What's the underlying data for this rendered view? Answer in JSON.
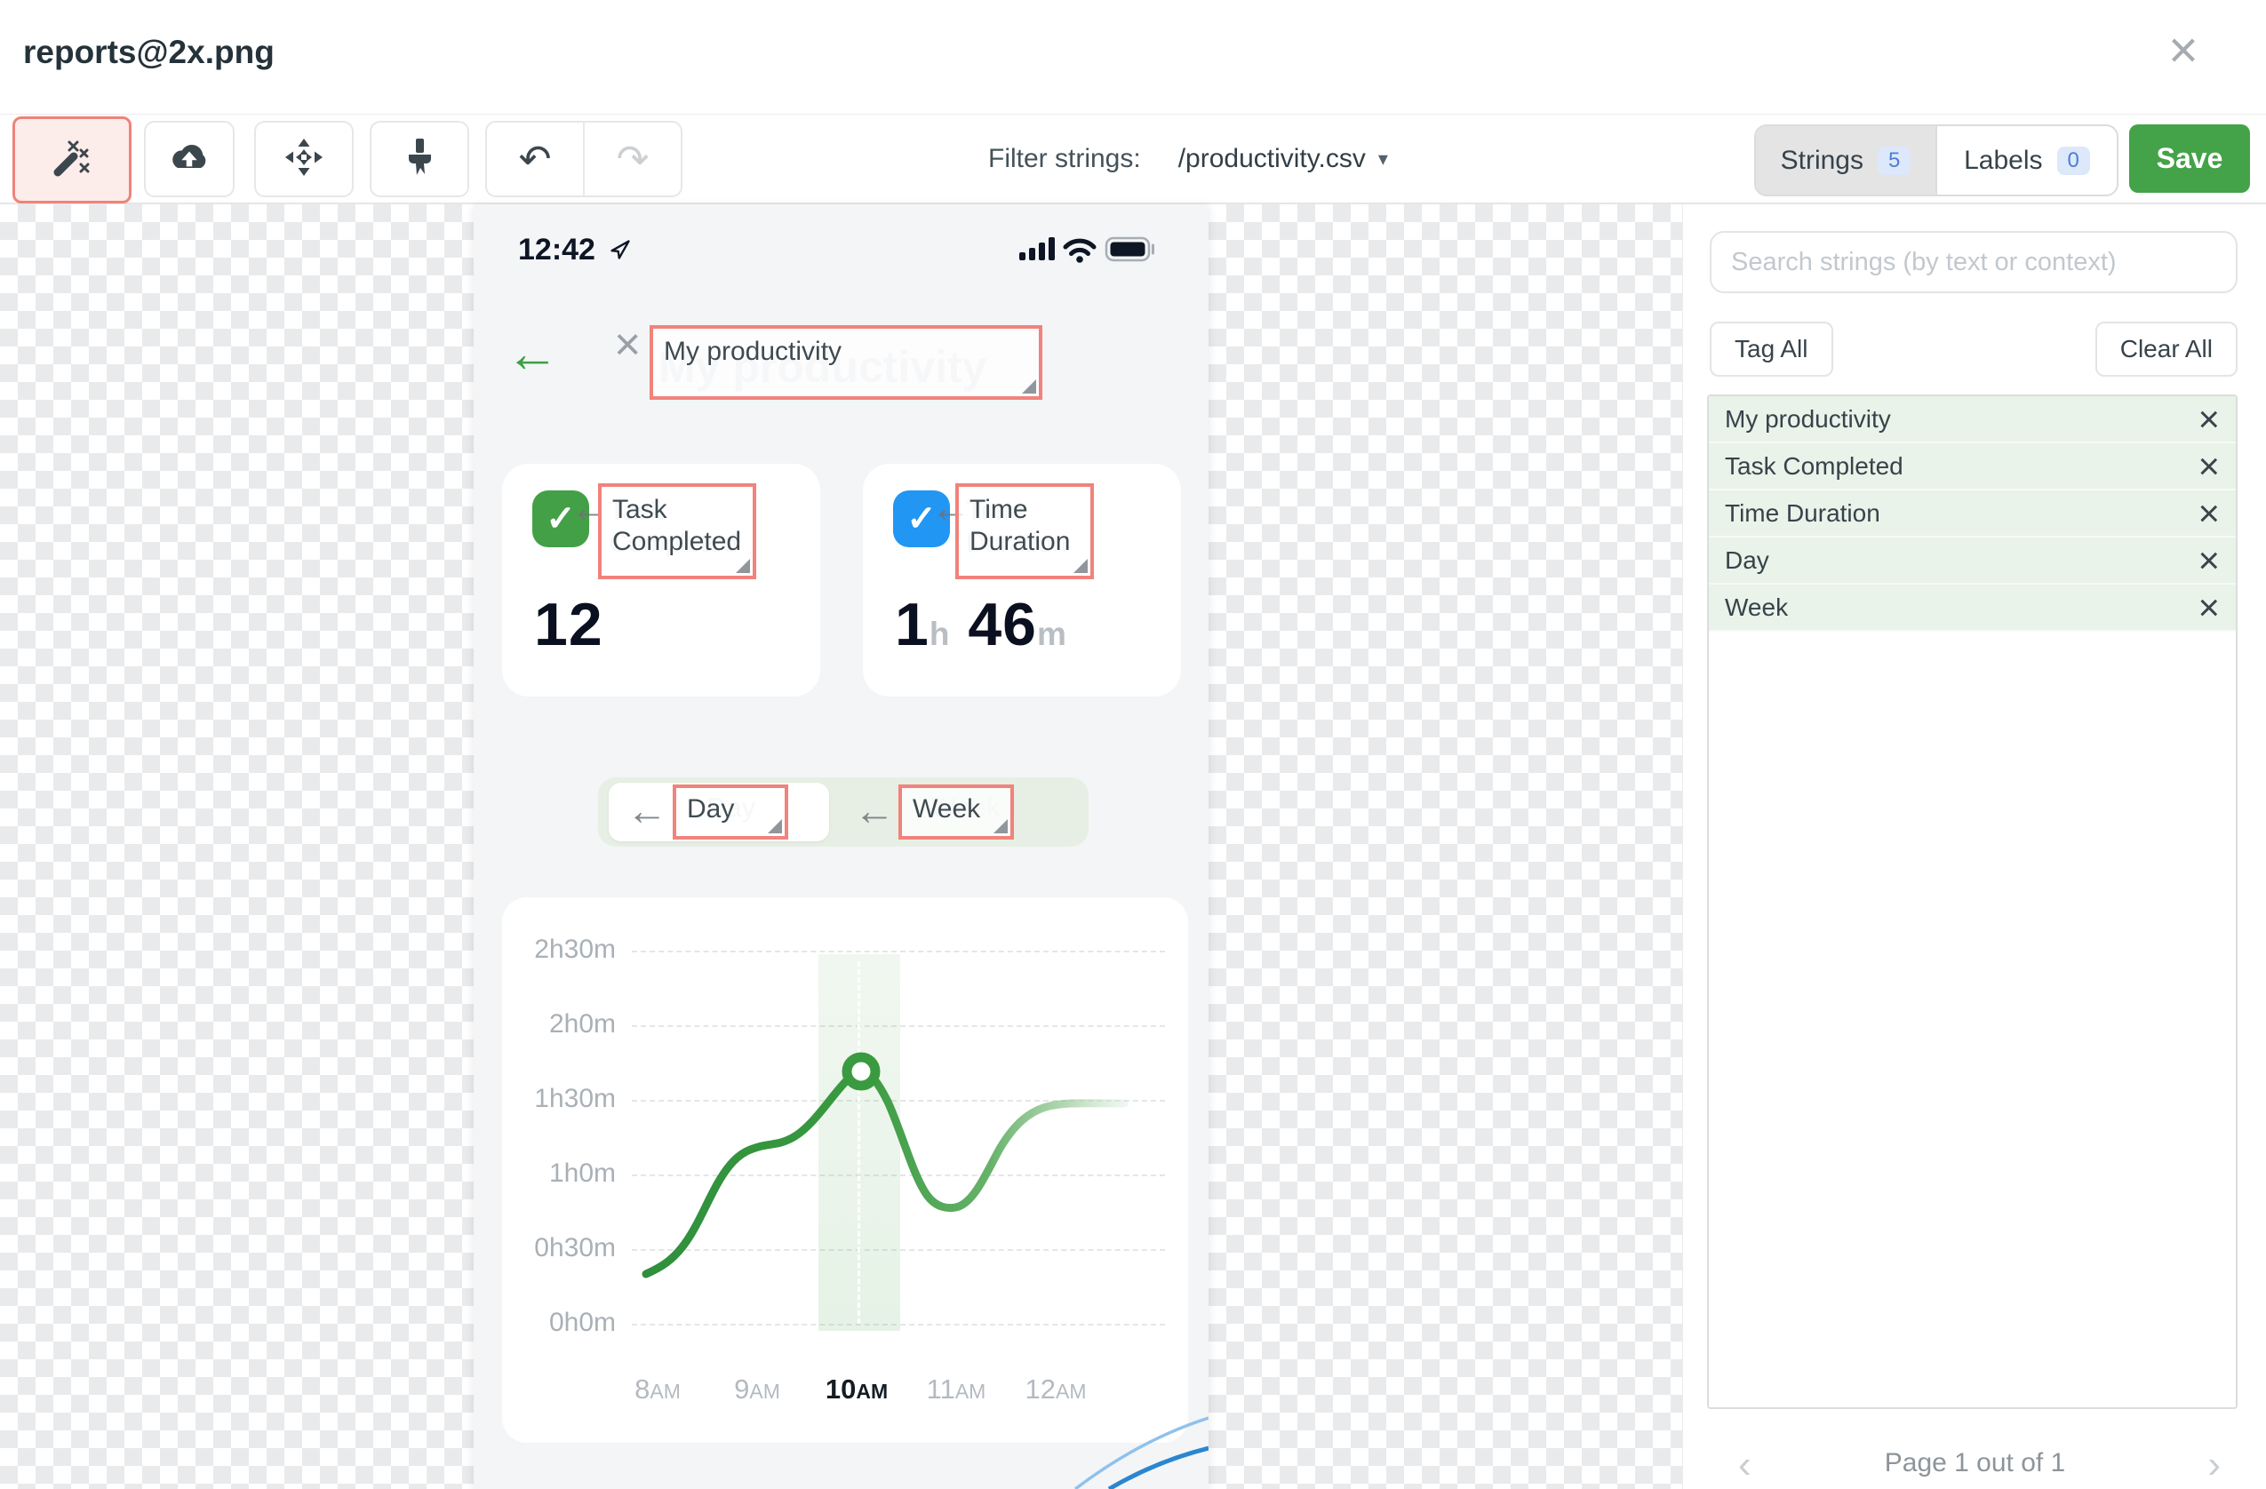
{
  "window": {
    "title": "reports@2x.png",
    "close_icon": "×"
  },
  "toolbar": {
    "filter_label": "Filter strings:",
    "filter_value": "/productivity.csv",
    "filter_caret": "▾",
    "undo_glyph": "↶",
    "redo_glyph": "↷",
    "tabs": {
      "strings_label": "Strings",
      "strings_count": "5",
      "labels_label": "Labels",
      "labels_count": "0"
    },
    "save_label": "Save"
  },
  "sidebar": {
    "search_placeholder": "Search strings (by text or context)",
    "tag_all_label": "Tag All",
    "clear_all_label": "Clear All",
    "remove_icon": "×",
    "strings": [
      {
        "text": "My productivity"
      },
      {
        "text": "Task Completed"
      },
      {
        "text": "Time Duration"
      },
      {
        "text": "Day"
      },
      {
        "text": "Week"
      }
    ],
    "pagination": {
      "prev_icon": "‹",
      "text": "Page 1 out of 1",
      "next_icon": "›"
    }
  },
  "phone": {
    "status": {
      "time": "12:42"
    },
    "header": {
      "back_icon": "←",
      "close_icon": "×",
      "title": "My productivity"
    },
    "anchor_icon": "←",
    "annotations": {
      "title": "My productivity",
      "task_line1": "Task",
      "task_line2": "Completed",
      "time_line1": "Time",
      "time_line2": "Duration",
      "day": "Day",
      "week": "Week"
    },
    "cards": [
      {
        "icon_glyph": "✓",
        "color": "#43a047",
        "value": "12"
      },
      {
        "icon_glyph": "✓",
        "color": "#2196f3",
        "value_h": "1",
        "unit_h": "h",
        "value_m": "46",
        "unit_m": "m"
      }
    ]
  },
  "chart_data": {
    "type": "line",
    "title": "",
    "x": [
      "8AM",
      "9AM",
      "10AM",
      "11AM",
      "12AM"
    ],
    "x_display": [
      {
        "num": "8",
        "ampm": "AM"
      },
      {
        "num": "9",
        "ampm": "AM"
      },
      {
        "num": "10",
        "ampm": "AM"
      },
      {
        "num": "11",
        "ampm": "AM"
      },
      {
        "num": "12",
        "ampm": "AM"
      }
    ],
    "values_minutes": [
      30,
      72,
      106,
      50,
      90
    ],
    "y_tick_labels": [
      "2h30m",
      "2h0m",
      "1h30m",
      "1h0m",
      "0h30m",
      "0h0m"
    ],
    "ylim_minutes": [
      0,
      150
    ],
    "grid": "dashed-horizontal",
    "legend": "none",
    "highlight_x": "10AM",
    "marker": {
      "x": "10AM",
      "value": "1h46m"
    },
    "line_color": "#3a9a40"
  },
  "colors": {
    "accent_green": "#43a047",
    "accent_blue": "#2196f3",
    "annotation_red": "#f0837c",
    "tag_row_green": "#e9f3e9",
    "badge_blue_bg": "#dde8fb",
    "badge_blue_text": "#4a7fd4",
    "save_green": "#44a248"
  }
}
